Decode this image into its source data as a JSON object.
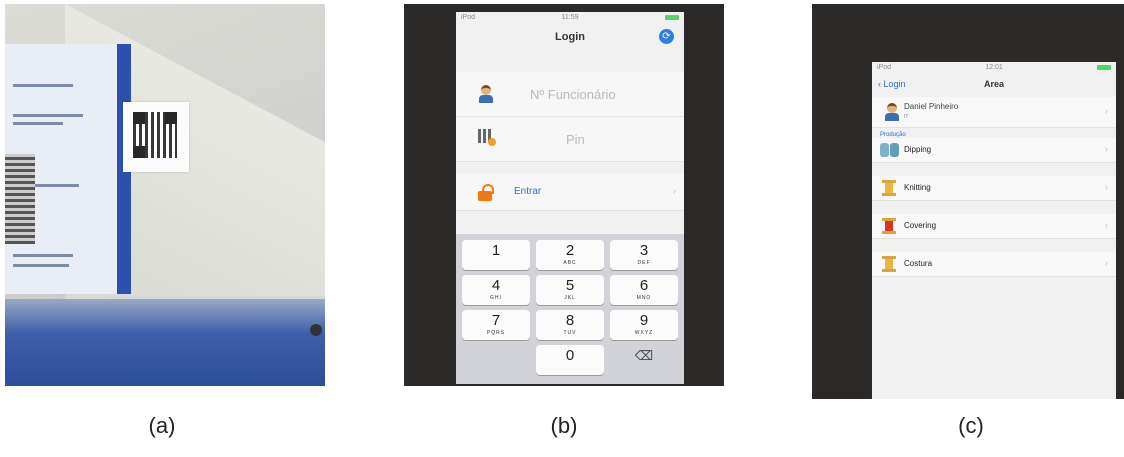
{
  "captions": {
    "a": "(a)",
    "b": "(b)",
    "c": "(c)"
  },
  "login_screen": {
    "status": {
      "carrier": "iPod",
      "time": "11:59"
    },
    "title": "Login",
    "employee_placeholder": "Nº Funcionário",
    "pin_placeholder": "Pin",
    "enter_label": "Entrar",
    "keys": [
      {
        "digit": "1",
        "letters": ""
      },
      {
        "digit": "2",
        "letters": "ABC"
      },
      {
        "digit": "3",
        "letters": "DEF"
      },
      {
        "digit": "4",
        "letters": "GHI"
      },
      {
        "digit": "5",
        "letters": "JKL"
      },
      {
        "digit": "6",
        "letters": "MNO"
      },
      {
        "digit": "7",
        "letters": "PQRS"
      },
      {
        "digit": "8",
        "letters": "TUV"
      },
      {
        "digit": "9",
        "letters": "WXYZ"
      },
      {
        "digit": "0",
        "letters": ""
      }
    ],
    "delete_key": "⌫"
  },
  "area_screen": {
    "status": {
      "carrier": "iPod",
      "time": "12:01"
    },
    "back_label": "Login",
    "title": "Area",
    "user_name": "Daniel Pinheiro",
    "user_sub": "IT",
    "section_header": "Produção",
    "areas": [
      "Dipping",
      "Knitting",
      "Covering",
      "Costura"
    ]
  }
}
